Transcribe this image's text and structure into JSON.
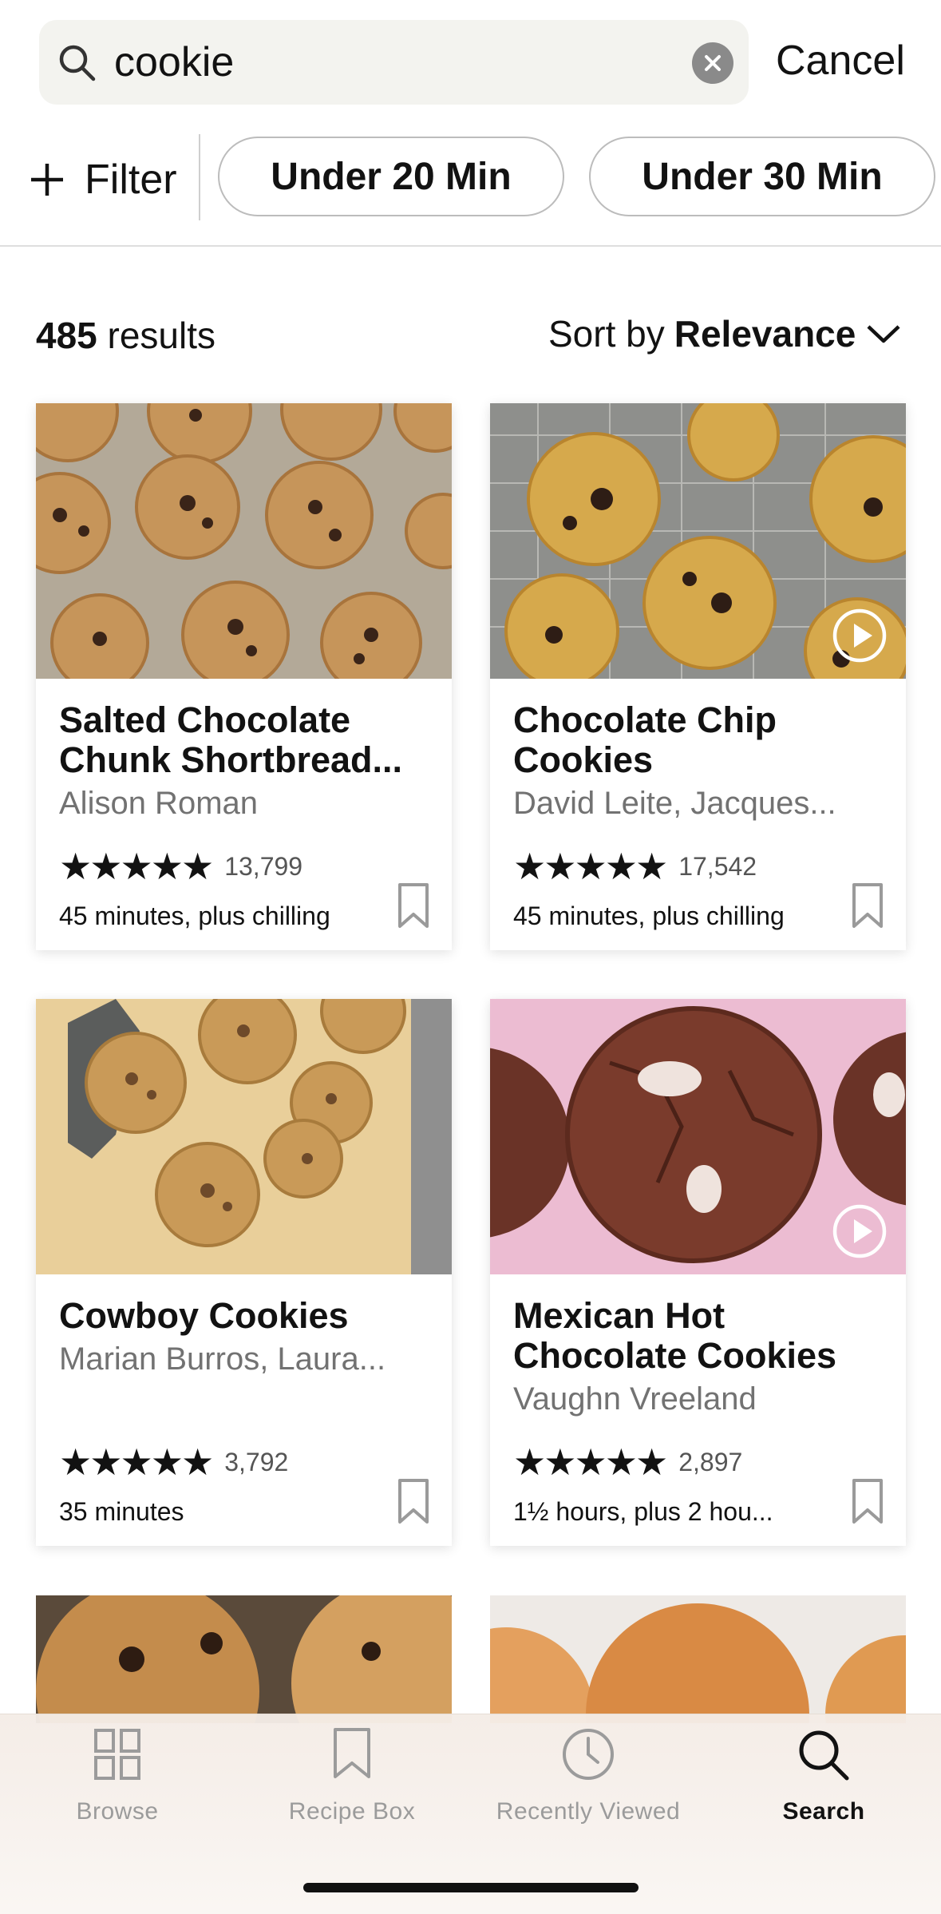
{
  "search": {
    "query": "cookie",
    "cancel_label": "Cancel"
  },
  "filters": {
    "filter_label": "Filter",
    "chips": [
      "Under 20 Min",
      "Under 30 Min"
    ]
  },
  "results": {
    "count": "485",
    "count_suffix": "results",
    "sort_prefix": "Sort by",
    "sort_value": "Relevance"
  },
  "recipes": [
    {
      "title": "Salted Chocolate Chunk Shortbread...",
      "author": "Alison Roman",
      "stars": "★★★★★",
      "rating_count": "13,799",
      "time": "45 minutes, plus chilling",
      "has_video": false
    },
    {
      "title": "Chocolate Chip Cookies",
      "author": "David Leite, Jacques...",
      "stars": "★★★★★",
      "rating_count": "17,542",
      "time": "45 minutes, plus chilling",
      "has_video": true
    },
    {
      "title": "Cowboy Cookies",
      "author": "Marian Burros, Laura...",
      "stars": "★★★★★",
      "rating_count": "3,792",
      "time": "35 minutes",
      "has_video": false
    },
    {
      "title": "Mexican Hot Chocolate Cookies",
      "author": "Vaughn Vreeland",
      "stars": "★★★★★",
      "rating_count": "2,897",
      "time": "1½ hours, plus 2 hou...",
      "has_video": true
    }
  ],
  "tabbar": {
    "tabs": [
      {
        "label": "Browse",
        "icon": "grid-icon",
        "active": false
      },
      {
        "label": "Recipe Box",
        "icon": "bookmark-icon",
        "active": false
      },
      {
        "label": "Recently Viewed",
        "icon": "clock-icon",
        "active": false
      },
      {
        "label": "Search",
        "icon": "search-icon",
        "active": true
      }
    ]
  },
  "colors": {
    "text": "#121212",
    "muted": "#727272",
    "search_bg": "#f3f3ef",
    "inactive_tab": "#9b9b9b"
  }
}
